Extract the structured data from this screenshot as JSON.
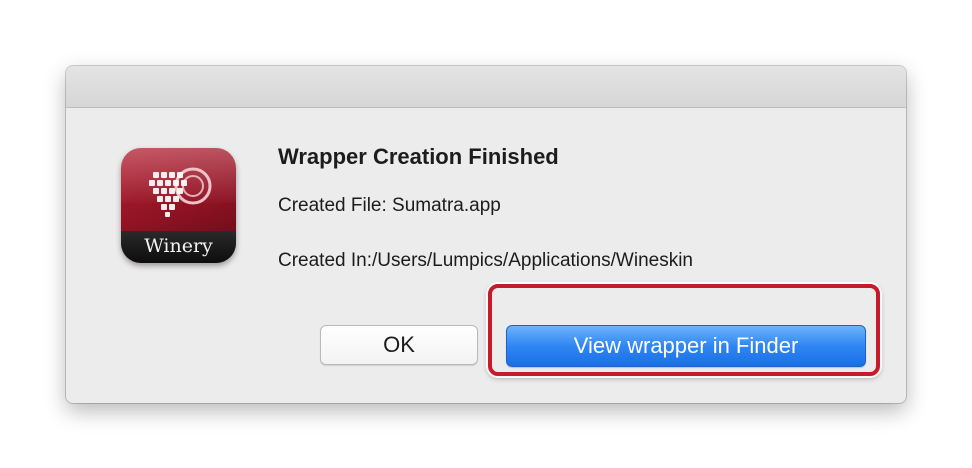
{
  "dialog": {
    "title": "Wrapper Creation Finished",
    "created_file": "Created File: Sumatra.app",
    "created_in": "Created In:/Users/Lumpics/Applications/Wineskin",
    "icon_label": "Winery",
    "icon_name": "winery-app-icon"
  },
  "buttons": {
    "ok_label": "OK",
    "view_label": "View wrapper in Finder"
  },
  "colors": {
    "primary_button": "#2f86f2",
    "highlight_frame": "#c71a2a",
    "icon_red": "#8e1222"
  }
}
